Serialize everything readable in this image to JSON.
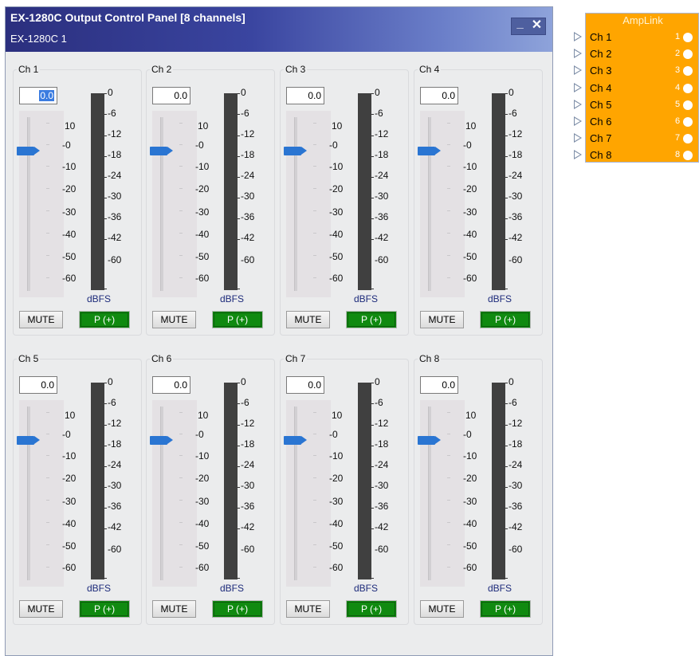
{
  "window": {
    "title": "EX-1280C Output Control Panel [8 channels]",
    "subtitle": "EX-1280C 1",
    "minimize_label": "_",
    "close_label": "✕"
  },
  "channels": [
    {
      "label": "Ch 1",
      "gain": "0.0",
      "gain_selected": true
    },
    {
      "label": "Ch 2",
      "gain": "0.0"
    },
    {
      "label": "Ch 3",
      "gain": "0.0"
    },
    {
      "label": "Ch 4",
      "gain": "0.0"
    },
    {
      "label": "Ch 5",
      "gain": "0.0"
    },
    {
      "label": "Ch 6",
      "gain": "0.0"
    },
    {
      "label": "Ch 7",
      "gain": "0.0"
    },
    {
      "label": "Ch 8",
      "gain": "0.0"
    }
  ],
  "fader_scale": [
    "10",
    "-0",
    "-10",
    "-20",
    "-30",
    "-40",
    "-50",
    "-60"
  ],
  "meter_scale": [
    "0",
    "-6",
    "-12",
    "-18",
    "-24",
    "-30",
    "-36",
    "-42",
    "-60"
  ],
  "meter_unit": "dBFS",
  "mute_label": "MUTE",
  "polarity_label": "P (+)",
  "colors": {
    "title_gradient_start": "#2b2f7e",
    "polarity_active": "#108a10",
    "fader_thumb": "#2a75d2",
    "meter_bar": "#404040",
    "amplink_block": "#ffa500"
  },
  "amplink": {
    "title": "AmpLink",
    "rows": [
      {
        "label": "Ch 1",
        "num": "1"
      },
      {
        "label": "Ch 2",
        "num": "2"
      },
      {
        "label": "Ch 3",
        "num": "3"
      },
      {
        "label": "Ch 4",
        "num": "4"
      },
      {
        "label": "Ch 5",
        "num": "5"
      },
      {
        "label": "Ch 6",
        "num": "6"
      },
      {
        "label": "Ch 7",
        "num": "7"
      },
      {
        "label": "Ch 8",
        "num": "8"
      }
    ]
  }
}
